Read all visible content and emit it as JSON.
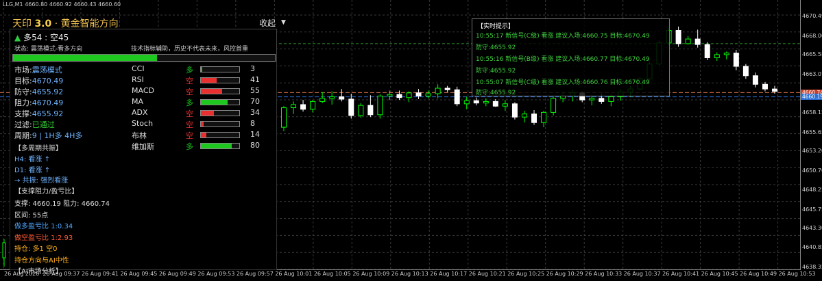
{
  "window": {
    "quote_line": "LLG,M1  4660.80 4660.92 4660.43 4660.60"
  },
  "colors": {
    "bull": "#00ff00",
    "bear": "#ffffff",
    "grid": "#3a3a3a",
    "bid_line": "#d0704a",
    "ask_line": "#2a6fd6",
    "resistance": "#6fb3ff",
    "target_line": "#2e8b2e"
  },
  "chart_data": {
    "type": "candlestick",
    "symbol": "LLG",
    "timeframe": "M1",
    "y_range": [
      4638.0,
      4672.6
    ],
    "bid": 4660.74,
    "ask": 4660.19,
    "target_level": 4667.0,
    "price_ticks": [
      "4670.49",
      "4668.00",
      "4665.58",
      "4663.07",
      "4660.74",
      "4660.19",
      "4658.15",
      "4655.65",
      "4653.20",
      "4650.70",
      "4648.25",
      "4645.75",
      "4643.30",
      "4640.85",
      "4638.35"
    ],
    "time_ticks": [
      "26 Aug 2026",
      "26 Aug 09:37",
      "26 Aug 09:41",
      "26 Aug 09:45",
      "26 Aug 09:49",
      "26 Aug 09:53",
      "26 Aug 09:57",
      "26 Aug 10:01",
      "26 Aug 10:05",
      "26 Aug 10:09",
      "26 Aug 10:13",
      "26 Aug 10:17",
      "26 Aug 10:21",
      "26 Aug 10:25",
      "26 Aug 10:29",
      "26 Aug 10:33",
      "26 Aug 10:37",
      "26 Aug 10:41",
      "26 Aug 10:45",
      "26 Aug 10:49",
      "26 Aug 10:53"
    ],
    "candles": [
      [
        4656.3,
        4659.0,
        4655.8,
        4658.8
      ],
      [
        4658.8,
        4659.6,
        4658.0,
        4659.2
      ],
      [
        4659.2,
        4659.8,
        4658.3,
        4658.6
      ],
      [
        4658.6,
        4659.8,
        4658.2,
        4659.6
      ],
      [
        4659.6,
        4660.8,
        4659.4,
        4660.0
      ],
      [
        4660.0,
        4660.9,
        4659.2,
        4660.2
      ],
      [
        4660.2,
        4661.2,
        4659.6,
        4659.9
      ],
      [
        4659.9,
        4660.6,
        4657.4,
        4657.8
      ],
      [
        4657.8,
        4659.4,
        4657.5,
        4659.1
      ],
      [
        4659.1,
        4660.4,
        4657.6,
        4657.9
      ],
      [
        4657.9,
        4660.5,
        4657.4,
        4660.3
      ],
      [
        4660.3,
        4661.0,
        4659.8,
        4660.5
      ],
      [
        4660.5,
        4661.0,
        4659.8,
        4660.1
      ],
      [
        4660.1,
        4660.9,
        4659.5,
        4660.7
      ],
      [
        4660.7,
        4661.2,
        4659.9,
        4660.3
      ],
      [
        4660.3,
        4661.0,
        4660.0,
        4660.6
      ],
      [
        4660.6,
        4661.8,
        4660.0,
        4661.3
      ],
      [
        4661.3,
        4661.6,
        4660.8,
        4661.1
      ],
      [
        4661.1,
        4661.5,
        4659.0,
        4659.3
      ],
      [
        4659.3,
        4660.2,
        4658.6,
        4659.7
      ],
      [
        4659.7,
        4660.1,
        4659.1,
        4659.4
      ],
      [
        4659.4,
        4660.0,
        4659.0,
        4659.6
      ],
      [
        4659.6,
        4659.9,
        4658.9,
        4659.0
      ],
      [
        4659.0,
        4659.8,
        4658.4,
        4659.3
      ],
      [
        4659.3,
        4659.5,
        4657.3,
        4657.6
      ],
      [
        4657.6,
        4658.4,
        4656.9,
        4658.0
      ],
      [
        4658.0,
        4658.5,
        4656.6,
        4656.9
      ],
      [
        4656.9,
        4658.4,
        4656.3,
        4658.2
      ],
      [
        4658.2,
        4660.2,
        4657.8,
        4660.0
      ],
      [
        4660.0,
        4660.8,
        4659.5,
        4660.3
      ],
      [
        4660.3,
        4661.1,
        4659.6,
        4660.7
      ],
      [
        4660.7,
        4660.9,
        4659.5,
        4659.8
      ],
      [
        4659.8,
        4660.4,
        4659.1,
        4660.0
      ],
      [
        4660.0,
        4660.6,
        4659.3,
        4659.6
      ],
      [
        4659.6,
        4660.5,
        4659.0,
        4660.2
      ],
      [
        4660.2,
        4661.2,
        4659.7,
        4660.8
      ],
      [
        4660.8,
        4661.6,
        4660.2,
        4661.2
      ],
      [
        4661.2,
        4662.8,
        4661.0,
        4662.5
      ],
      [
        4662.5,
        4664.7,
        4662.3,
        4664.4
      ],
      [
        4664.4,
        4667.4,
        4664.2,
        4667.1
      ],
      [
        4667.1,
        4669.0,
        4666.8,
        4668.7
      ],
      [
        4668.7,
        4669.2,
        4666.6,
        4667.0
      ],
      [
        4667.0,
        4668.0,
        4666.9,
        4667.6
      ],
      [
        4667.6,
        4668.8,
        4666.5,
        4666.9
      ],
      [
        4666.9,
        4667.2,
        4664.9,
        4665.2
      ],
      [
        4665.2,
        4665.9,
        4664.8,
        4665.6
      ],
      [
        4665.6,
        4666.0,
        4665.0,
        4665.8
      ],
      [
        4665.8,
        4666.2,
        4663.6,
        4664.1
      ],
      [
        4664.1,
        4664.4,
        4662.5,
        4662.9
      ],
      [
        4662.9,
        4663.3,
        4661.4,
        4661.8
      ],
      [
        4661.8,
        4662.1,
        4660.9,
        4661.2
      ],
      [
        4661.2,
        4661.6,
        4660.6,
        4660.9
      ]
    ]
  },
  "header": {
    "title_brand": "天印",
    "title_version": "3.0",
    "title_rest": "· 黄金智能方向",
    "collapse_label": "收起",
    "collapse_arrow": "▼"
  },
  "status": {
    "ratio_icon": "▲",
    "ratio_text": "多54 : 空45",
    "state_text": "状态: 震荡模式-看多方向",
    "disclaimer": "技术指标辅助，历史不代表未来，风控首重",
    "progress": 0.55
  },
  "panel": {
    "market": {
      "label": "市场:",
      "value": "震荡模式"
    },
    "target": {
      "label": "目标:",
      "value": "4670.49"
    },
    "stop": {
      "label": "防守:",
      "value": "4655.92"
    },
    "resistance": {
      "label": "阻力:",
      "value": "4670.49"
    },
    "support": {
      "label": "支撑:",
      "value": "4655.92"
    },
    "filter": {
      "label": "过滤:",
      "value": "已通过"
    },
    "period": {
      "label": "周期:",
      "value": "9 | 1H多 4H多"
    },
    "indicators": [
      {
        "name": "CCI",
        "dir": "多",
        "value": 3,
        "color": "#1ec81e"
      },
      {
        "name": "RSI",
        "dir": "空",
        "value": 41,
        "color": "#e83030"
      },
      {
        "name": "MACD",
        "dir": "空",
        "value": 55,
        "color": "#e83030"
      },
      {
        "name": "MA",
        "dir": "多",
        "value": 70,
        "color": "#1ec81e"
      },
      {
        "name": "ADX",
        "dir": "空",
        "value": 34,
        "color": "#e83030"
      },
      {
        "name": "Stoch",
        "dir": "空",
        "value": 8,
        "color": "#e83030"
      },
      {
        "name": "布林",
        "dir": "空",
        "value": 14,
        "color": "#e83030"
      },
      {
        "name": "维加斯",
        "dir": "多",
        "value": 80,
        "color": "#1ec81e"
      }
    ],
    "multi_tf_header": "【多周期共振】",
    "h4": "H4: 看涨 ↑",
    "d1": "D1: 看涨 ↑",
    "resonance": "→ 共振: 强烈看涨",
    "sr_header": "【支撑阻力/盈亏比】",
    "sr_line": "支撑: 4660.19 阻力: 4660.74",
    "range": "区间: 55点",
    "long_ratio": "做多盈亏比 1:0.34",
    "short_ratio": "做空盈亏比 1:2.93",
    "position": "持仓: 多1 空0",
    "position_dir": "持仓方向与AI中性",
    "ai_header": "【AI市场分析】"
  },
  "alerts": {
    "header": "【实时提示】",
    "lines": [
      "10:55:17 新信号(C级) 看涨 建议入场:4660.75 目标:4670.49",
      "防守:4655.92",
      "10:55:16 新信号(B级) 看涨 建议入场:4660.77 目标:4670.49",
      "防守:4655.92",
      "10:55:07 新信号(C级) 看涨 建议入场:4660.76 目标:4670.49",
      "防守:4655.92"
    ]
  }
}
